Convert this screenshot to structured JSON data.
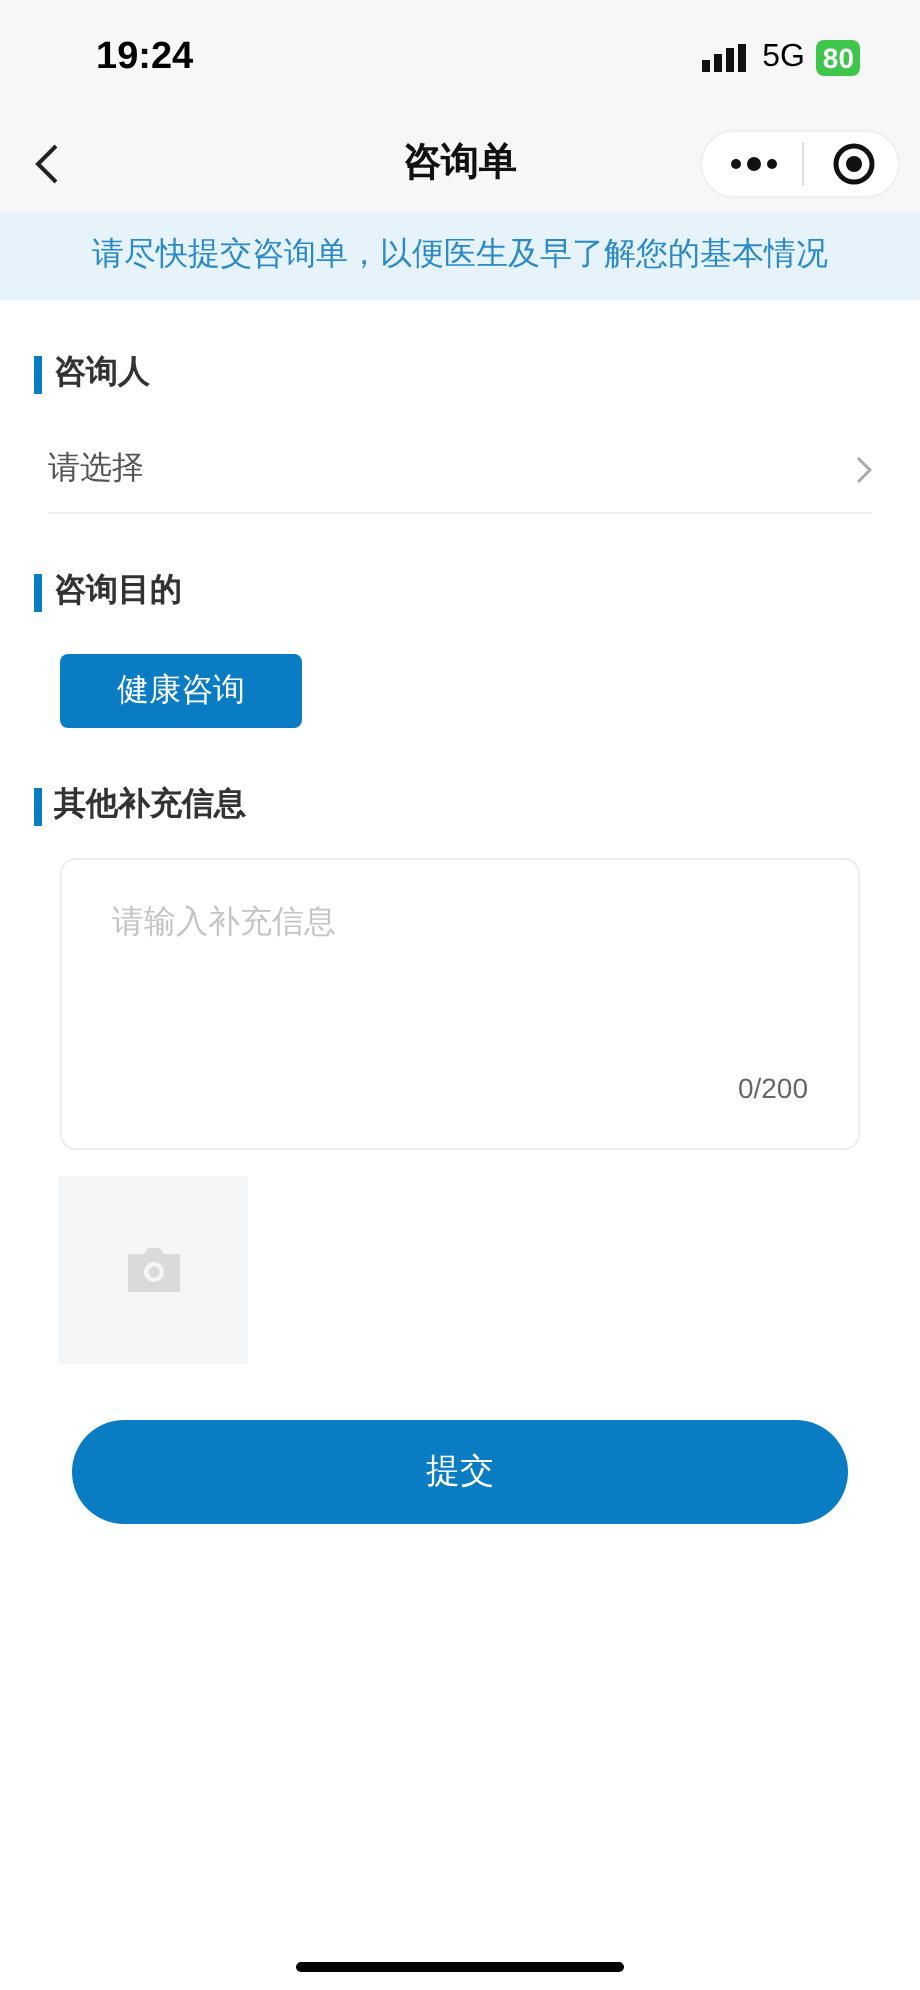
{
  "status_bar": {
    "time": "19:24",
    "network": "5G",
    "battery": "80"
  },
  "nav": {
    "title": "咨询单"
  },
  "notice": "请尽快提交咨询单，以便医生及早了解您的基本情况",
  "consultant": {
    "heading": "咨询人",
    "placeholder": "请选择"
  },
  "purpose": {
    "heading": "咨询目的",
    "options": [
      {
        "label": "健康咨询",
        "selected": true
      }
    ]
  },
  "extra": {
    "heading": "其他补充信息",
    "placeholder": "请输入补充信息",
    "counter": "0/200"
  },
  "submit": "提交"
}
